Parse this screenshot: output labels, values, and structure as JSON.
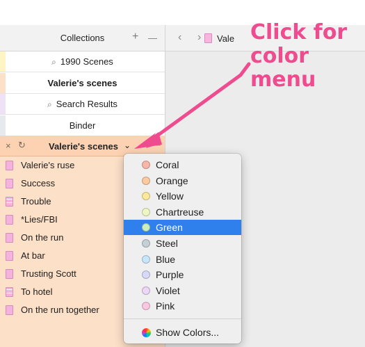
{
  "collections": {
    "title": "Collections",
    "add_label": "+",
    "remove_label": "—",
    "rows": [
      {
        "label": "1990 Scenes",
        "icon": "search-icon",
        "bold": false,
        "color": "#fff4c4"
      },
      {
        "label": "Valerie's scenes",
        "icon": "",
        "bold": true,
        "color": "#fde0c8"
      },
      {
        "label": "Search Results",
        "icon": "search-icon",
        "bold": false,
        "color": "#efe2f7"
      },
      {
        "label": "Binder",
        "icon": "",
        "bold": false,
        "color": "#e6e9ee"
      }
    ]
  },
  "editor": {
    "back_label": "‹",
    "forward_label": "›",
    "doc_title": "Vale"
  },
  "scenes_header": {
    "close_label": "×",
    "refresh_label": "↻",
    "title": "Valerie's scenes",
    "chevron": "⌄",
    "minus_label": "—"
  },
  "scenes": [
    {
      "label": "Valerie's ruse",
      "lined": false
    },
    {
      "label": "Success",
      "lined": false
    },
    {
      "label": "Trouble",
      "lined": true
    },
    {
      "label": "*Lies/FBI",
      "lined": false
    },
    {
      "label": "On the run",
      "lined": false
    },
    {
      "label": "At bar",
      "lined": false
    },
    {
      "label": "Trusting Scott",
      "lined": false
    },
    {
      "label": "To hotel",
      "lined": true
    },
    {
      "label": "On the run together",
      "lined": false
    }
  ],
  "color_menu": {
    "items": [
      {
        "label": "Coral",
        "color": "#f6b6a8"
      },
      {
        "label": "Orange",
        "color": "#fccaa0"
      },
      {
        "label": "Yellow",
        "color": "#fde89a"
      },
      {
        "label": "Chartreuse",
        "color": "#eef7c4"
      },
      {
        "label": "Green",
        "color": "#c9efc0"
      },
      {
        "label": "Steel",
        "color": "#c4cfd6"
      },
      {
        "label": "Blue",
        "color": "#c7e6fb"
      },
      {
        "label": "Purple",
        "color": "#d8d9f7"
      },
      {
        "label": "Violet",
        "color": "#ebd7f7"
      },
      {
        "label": "Pink",
        "color": "#f9c7df"
      }
    ],
    "selected": "Green",
    "show_colors_label": "Show Colors..."
  },
  "annotation": {
    "text": "Click for color menu",
    "color": "#ef4b8f"
  },
  "accent_color": "#2f80ed"
}
